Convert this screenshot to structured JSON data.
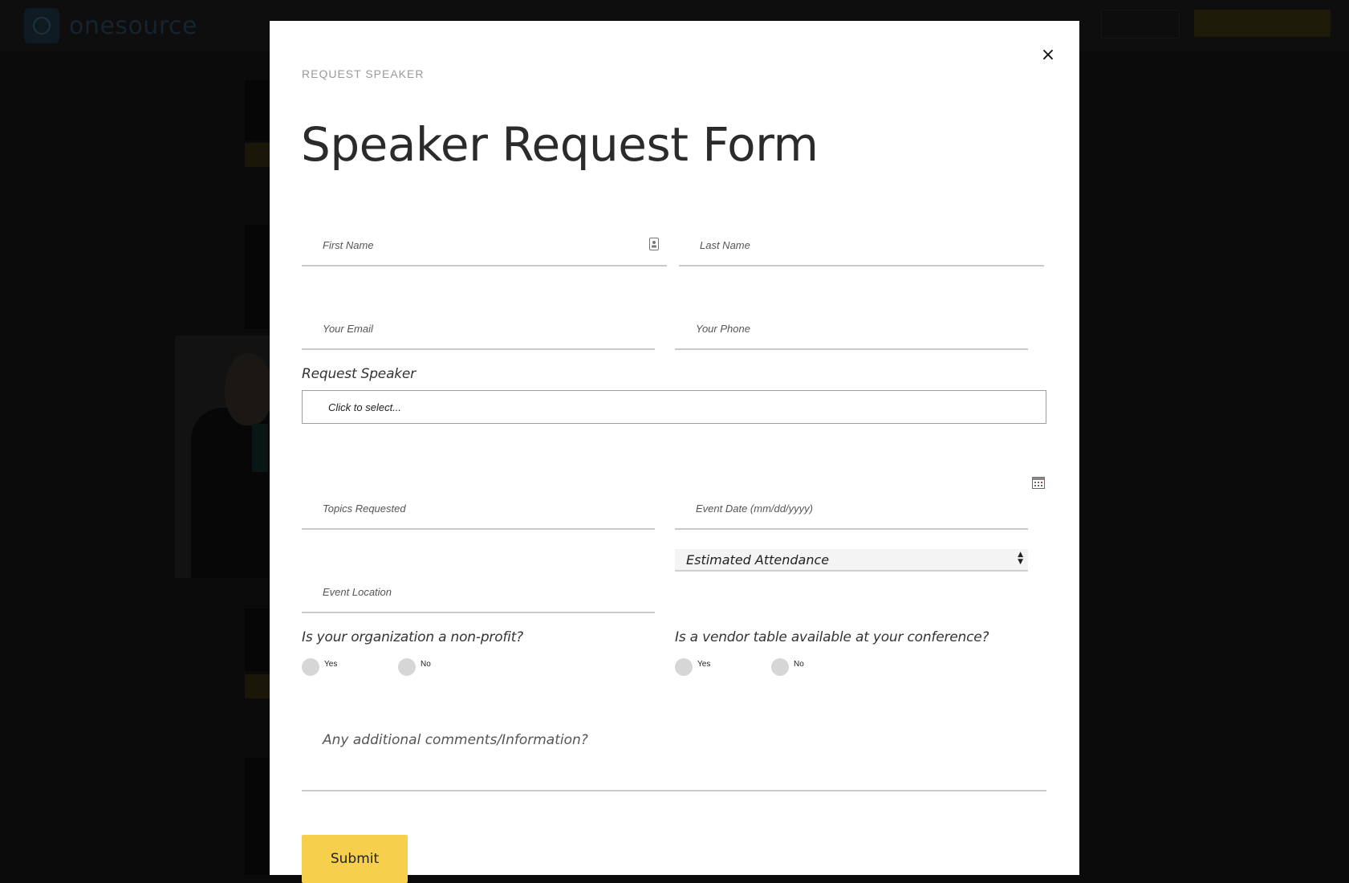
{
  "background": {
    "logo_text": "onesource"
  },
  "modal": {
    "close_label": "×",
    "eyebrow": "REQUEST SPEAKER",
    "title": "Speaker Request Form",
    "fields": {
      "first_name": {
        "placeholder": "First Name",
        "value": ""
      },
      "last_name": {
        "placeholder": "Last Name",
        "value": ""
      },
      "email": {
        "placeholder": "Your Email",
        "value": ""
      },
      "phone": {
        "placeholder": "Your Phone",
        "value": ""
      },
      "topics": {
        "placeholder": "Topics Requested",
        "value": ""
      },
      "event_date": {
        "placeholder": "Event Date (mm/dd/yyyy)",
        "value": ""
      },
      "event_location": {
        "placeholder": "Event Location",
        "value": ""
      }
    },
    "request_speaker": {
      "label": "Request Speaker",
      "placeholder": "Click to select..."
    },
    "attendance_select": {
      "selected": "Estimated Attendance"
    },
    "nonprofit": {
      "question": "Is your organization a non-profit?",
      "yes": "Yes",
      "no": "No"
    },
    "vendor_table": {
      "question": "Is a vendor table available at your conference?",
      "yes": "Yes",
      "no": "No"
    },
    "comments": {
      "placeholder": "Any additional comments/Information?"
    },
    "submit_label": "Submit",
    "colors": {
      "submit_bg": "#f6d04d",
      "underline": "#c9c9c9",
      "radio": "#d6d6d6"
    }
  }
}
